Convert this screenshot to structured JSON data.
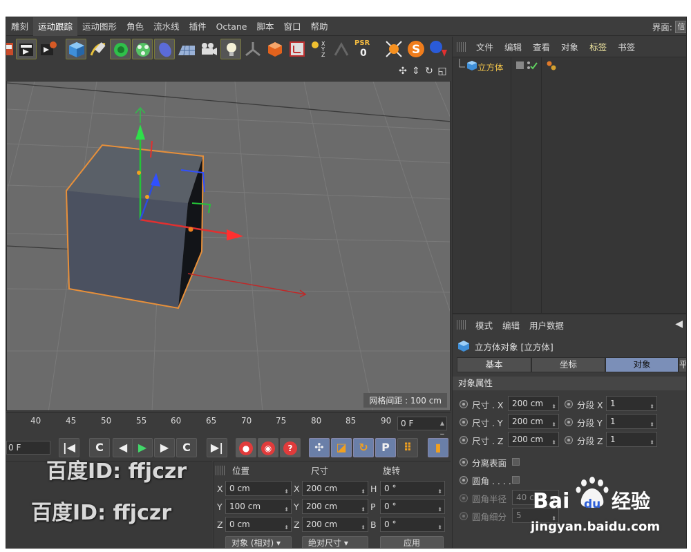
{
  "menu": {
    "items": [
      "雕刻",
      "运动跟踪",
      "运动图形",
      "角色",
      "流水线",
      "插件",
      "Octane",
      "脚本",
      "窗口",
      "帮助"
    ],
    "active_index": 1,
    "layout_label": "界面:",
    "layout_value": "信"
  },
  "toolbar": {
    "psr_label": "PSR",
    "psr_value": "0"
  },
  "viewport": {
    "grid_spacing": "网格间距 : 100 cm"
  },
  "timeline": {
    "ticks": [
      "40",
      "45",
      "50",
      "55",
      "60",
      "65",
      "70",
      "75",
      "80",
      "85",
      "90"
    ],
    "end_frame": "0 F",
    "current_frame": "0 F"
  },
  "transport": {
    "first": "K",
    "prev_key": "C",
    "prev_frame": "◀",
    "play": "▶",
    "next_frame": "▶",
    "next_key": "C",
    "last": "▶|",
    "rec_q": "?",
    "p": "P"
  },
  "coords": {
    "header_position": "位置",
    "header_size": "尺寸",
    "header_rotation": "旋转",
    "rows": [
      {
        "axis": "X",
        "pos": "0 cm",
        "size_axis": "X",
        "size": "200 cm",
        "rot_axis": "H",
        "rot": "0 °"
      },
      {
        "axis": "Y",
        "pos": "100 cm",
        "size_axis": "Y",
        "size": "200 cm",
        "rot_axis": "P",
        "rot": "0 °"
      },
      {
        "axis": "Z",
        "pos": "0 cm",
        "size_axis": "Z",
        "size": "200 cm",
        "rot_axis": "B",
        "rot": "0 °"
      }
    ],
    "mode_dropdown": "对象 (相对)",
    "size_dropdown": "绝对尺寸",
    "apply": "应用"
  },
  "object_manager": {
    "menu": [
      "文件",
      "编辑",
      "查看",
      "对象",
      "标签",
      "书签"
    ],
    "objects": [
      {
        "name": "立方体"
      }
    ]
  },
  "attribute_manager": {
    "menu": [
      "模式",
      "编辑",
      "用户数据"
    ],
    "title": "立方体对象 [立方体]",
    "tabs": [
      "基本",
      "坐标",
      "对象",
      "平"
    ],
    "active_tab": 2,
    "section": "对象属性",
    "props": [
      {
        "label": "尺寸 . X",
        "value": "200 cm",
        "seg_label": "分段 X",
        "seg_value": "1"
      },
      {
        "label": "尺寸 . Y",
        "value": "200 cm",
        "seg_label": "分段 Y",
        "seg_value": "1"
      },
      {
        "label": "尺寸 . Z",
        "value": "200 cm",
        "seg_label": "分段 Z",
        "seg_value": "1"
      }
    ],
    "separate_faces": "分离表面",
    "fillet": "圆角 . . . .",
    "fillet_radius_label": "圆角半径",
    "fillet_radius_value": "40 cm",
    "fillet_subdiv_label": "圆角细分",
    "fillet_subdiv_value": "5"
  },
  "watermarks": {
    "id_1": "百度ID: ffjczr",
    "id_2": "百度ID: ffjczr",
    "baidu_text": "Bai du 经验",
    "baidu_url": "jingyan.baidu.com"
  },
  "colors": {
    "panel_bg": "#3b3b3b",
    "viewport_bg": "#6b6b6b",
    "active_tab": "#7b8fb8",
    "object_name": "#f0c34a",
    "selection_outline": "#e8903a"
  }
}
